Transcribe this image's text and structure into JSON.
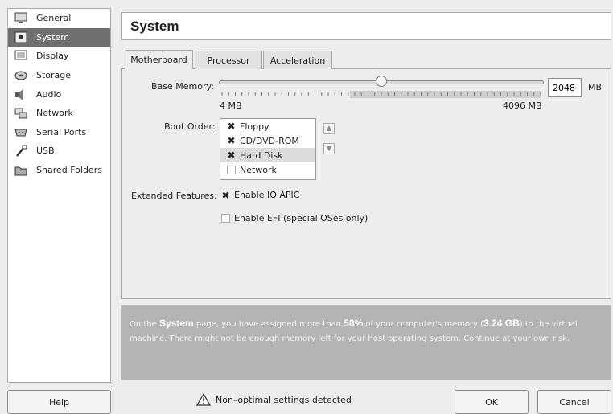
{
  "title": "System",
  "sidebar": {
    "items": [
      {
        "label": "General",
        "icon": "monitor-icon",
        "selected": false
      },
      {
        "label": "System",
        "icon": "chip-icon",
        "selected": true
      },
      {
        "label": "Display",
        "icon": "display-icon",
        "selected": false
      },
      {
        "label": "Storage",
        "icon": "disk-icon",
        "selected": false
      },
      {
        "label": "Audio",
        "icon": "speaker-icon",
        "selected": false
      },
      {
        "label": "Network",
        "icon": "network-icon",
        "selected": false
      },
      {
        "label": "Serial Ports",
        "icon": "serial-icon",
        "selected": false
      },
      {
        "label": "USB",
        "icon": "usb-icon",
        "selected": false
      },
      {
        "label": "Shared Folders",
        "icon": "folder-icon",
        "selected": false
      }
    ]
  },
  "tabs": [
    {
      "label": "Motherboard",
      "active": true
    },
    {
      "label": "Processor",
      "active": false
    },
    {
      "label": "Acceleration",
      "active": false
    }
  ],
  "base_memory": {
    "label": "Base Memory:",
    "min_label": "4 MB",
    "max_label": "4096 MB",
    "value": "2048",
    "unit": "MB",
    "min": 4,
    "max": 4096,
    "current": 2048
  },
  "boot_order": {
    "label": "Boot Order:",
    "items": [
      {
        "label": "Floppy",
        "checked": true
      },
      {
        "label": "CD/DVD-ROM",
        "checked": true
      },
      {
        "label": "Hard Disk",
        "checked": true,
        "selected": true
      },
      {
        "label": "Network",
        "checked": false
      }
    ],
    "up_arrow": "▲",
    "down_arrow": "▼"
  },
  "extended_features": {
    "label": "Extended Features:",
    "io_apic": {
      "label": "Enable IO APIC",
      "checked": true
    },
    "efi": {
      "label": "Enable EFI (special OSes only)",
      "checked": false
    }
  },
  "warning": {
    "p1": "On the ",
    "page_name": "System",
    "p2": " page, you have assigned more than ",
    "percent": "50%",
    "p3": " of your computer's memory (",
    "amount": "3.24 GB",
    "p4": ") to the virtual machine. There might not be enough memory left for your host operating system. Continue at your own risk."
  },
  "status": {
    "icon": "warning-icon",
    "text": "Non–optimal settings detected"
  },
  "buttons": {
    "help": "Help",
    "ok": "OK",
    "cancel": "Cancel"
  },
  "check_glyph": "✖"
}
